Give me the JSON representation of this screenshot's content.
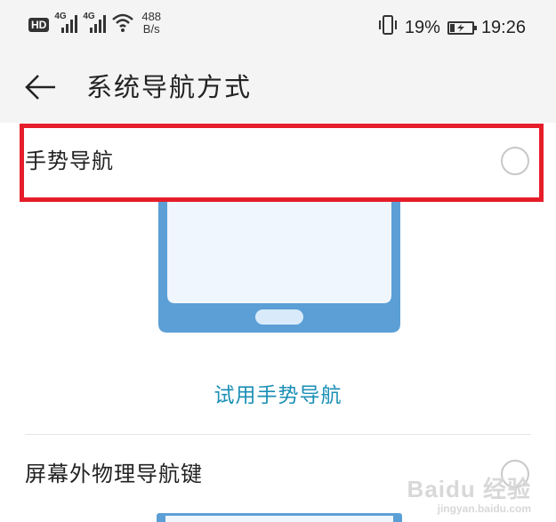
{
  "status_bar": {
    "hd_label": "HD",
    "signal_label": "4G",
    "net_speed_value": "488",
    "net_speed_unit": "B/s",
    "battery_percent": "19%",
    "time": "19:26",
    "battery_level": 0.19
  },
  "header": {
    "title": "系统导航方式"
  },
  "options": [
    {
      "label": "手势导航",
      "selected": false,
      "try_link": "试用手势导航"
    },
    {
      "label": "屏幕外物理导航键",
      "selected": false
    }
  ],
  "watermark": {
    "brand": "Baidu 经验",
    "url": "jingyan.baidu.com"
  },
  "colors": {
    "highlight_border": "#e61d2a",
    "link": "#1a8fb5",
    "phone_frame": "#5b9fd6",
    "phone_screen": "#f0f6fd",
    "header_bg": "#f4f4f4"
  }
}
